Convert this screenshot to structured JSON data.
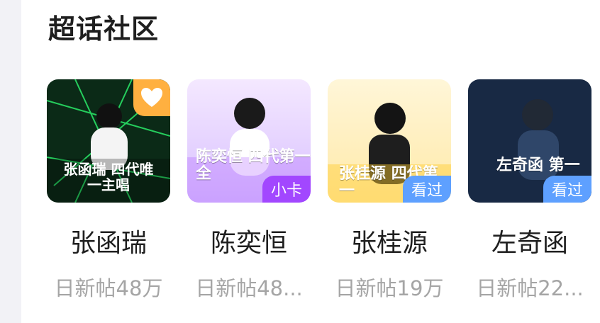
{
  "section": {
    "title": "超话社区"
  },
  "cards": [
    {
      "name": "张函瑞",
      "stat": "日新帖48万",
      "overlay_text": "张函瑞 四代唯一主唱",
      "tag": "",
      "icon": "heart-icon",
      "colors": {
        "bg": "#0b2a17",
        "accent": "#29e065"
      }
    },
    {
      "name": "陈奕恒",
      "stat": "日新帖48...",
      "overlay_text": "陈奕恒 四代第一全",
      "tag": "小卡",
      "colors": {
        "bg": "#eadcff",
        "accent": "#a247ff"
      }
    },
    {
      "name": "张桂源",
      "stat": "日新帖19万",
      "overlay_text": "张桂源 四代第一",
      "tag": "看过",
      "colors": {
        "bg": "#fff3c8",
        "accent": "#ffcc2e"
      }
    },
    {
      "name": "左奇函",
      "stat": "日新帖22...",
      "overlay_text": "左奇函 第一",
      "tag": "看过",
      "colors": {
        "bg": "#0f1a2b",
        "accent": "#5ea0ff"
      }
    }
  ]
}
